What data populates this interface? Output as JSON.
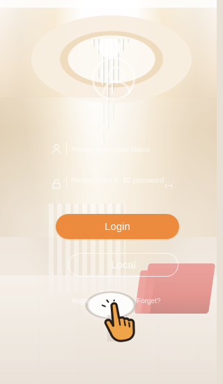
{
  "login": {
    "username_placeholder": "Please input User Name",
    "password_placeholder": "Please enter 6~20 password",
    "login_label": "Login",
    "local_label": "Local",
    "register_label": "Register",
    "forget_label": "Forget?"
  },
  "icons": {
    "username": "user-icon",
    "password": "lock-icon",
    "password_visibility": "eye-closed-icon",
    "pointer": "pointing-hand-icon"
  },
  "colors": {
    "accent": "#ec8a3d",
    "text_light": "#ffffff",
    "hand": "#f0a448",
    "hand_outline": "#2b2017"
  }
}
